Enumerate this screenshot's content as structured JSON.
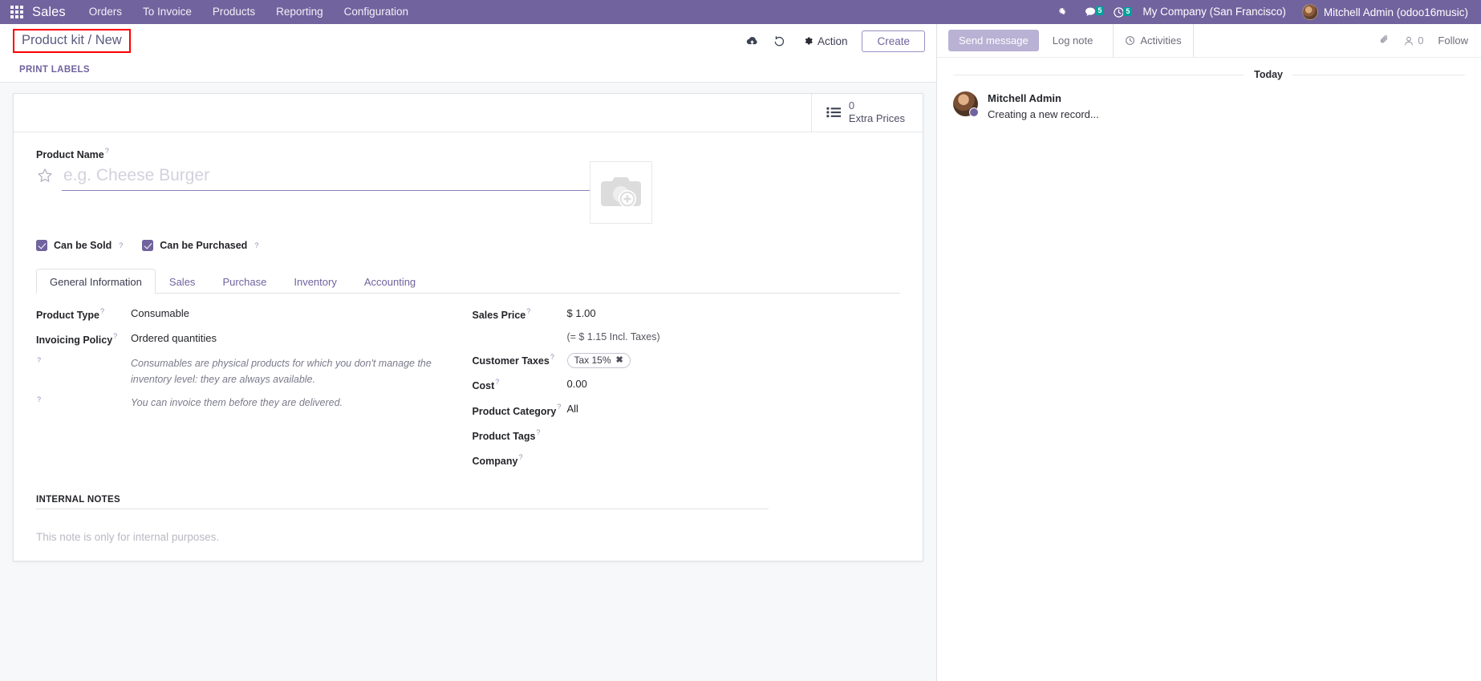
{
  "navbar": {
    "apps_icon": "apps-grid-icon",
    "brand": "Sales",
    "menus": [
      "Orders",
      "To Invoice",
      "Products",
      "Reporting",
      "Configuration"
    ],
    "systray": [
      {
        "icon": "bug-icon",
        "name": "debug",
        "badge": null
      },
      {
        "icon": "chat-bubble-icon",
        "name": "messages",
        "badge": "5"
      },
      {
        "icon": "clock-icon",
        "name": "activities",
        "badge": "5"
      }
    ],
    "company": "My Company (San Francisco)",
    "user": "Mitchell Admin (odoo16music)",
    "accent": "#71639e",
    "badge_color": "#00a09d"
  },
  "control_panel": {
    "breadcrumb": "Product kit / New",
    "breadcrumb_highlight_color": "#ff0000",
    "save_icon": "cloud-upload-icon",
    "discard_icon": "undo-icon",
    "action_label": "Action",
    "action_icon": "gear-icon",
    "create_label": "Create",
    "print_labels_label": "PRINT LABELS"
  },
  "stat_buttons": [
    {
      "icon": "list-icon",
      "value": "0",
      "label": "Extra Prices"
    }
  ],
  "product": {
    "name_label": "Product Name",
    "name_value": "",
    "name_placeholder": "e.g. Cheese Burger",
    "favorite_icon": "star-icon",
    "image_icon": "camera-plus-icon",
    "checkboxes": [
      {
        "label": "Can be Sold",
        "checked": true
      },
      {
        "label": "Can be Purchased",
        "checked": true
      }
    ]
  },
  "tabs": [
    {
      "label": "General Information",
      "active": true
    },
    {
      "label": "Sales",
      "active": false
    },
    {
      "label": "Purchase",
      "active": false
    },
    {
      "label": "Inventory",
      "active": false
    },
    {
      "label": "Accounting",
      "active": false
    }
  ],
  "general_info": {
    "left": {
      "product_type_label": "Product Type",
      "product_type_value": "Consumable",
      "invoicing_policy_label": "Invoicing Policy",
      "invoicing_policy_value": "Ordered quantities",
      "hint_1": "Consumables are physical products for which you don't manage the inventory level: they are always available.",
      "hint_2": "You can invoice them before they are delivered."
    },
    "right": {
      "sales_price_label": "Sales Price",
      "sales_price_value": "$ 1.00",
      "sales_price_sub": "(= $ 1.15 Incl. Taxes)",
      "customer_taxes_label": "Customer Taxes",
      "customer_taxes_tag": "Tax 15%",
      "cost_label": "Cost",
      "cost_value": "0.00",
      "product_category_label": "Product Category",
      "product_category_value": "All",
      "product_tags_label": "Product Tags",
      "product_tags_value": "",
      "company_label": "Company",
      "company_value": ""
    }
  },
  "internal_notes": {
    "title": "INTERNAL NOTES",
    "placeholder": "This note is only for internal purposes."
  },
  "chatter": {
    "send_message_label": "Send message",
    "log_note_label": "Log note",
    "activities_label": "Activities",
    "activities_icon": "clock-icon",
    "attachment_icon": "paperclip-icon",
    "followers_icon": "person-icon",
    "followers_count": "0",
    "follow_label": "Follow",
    "day_separator": "Today",
    "messages": [
      {
        "author": "Mitchell Admin",
        "body": "Creating a new record...",
        "avatar": "avatar"
      }
    ]
  }
}
